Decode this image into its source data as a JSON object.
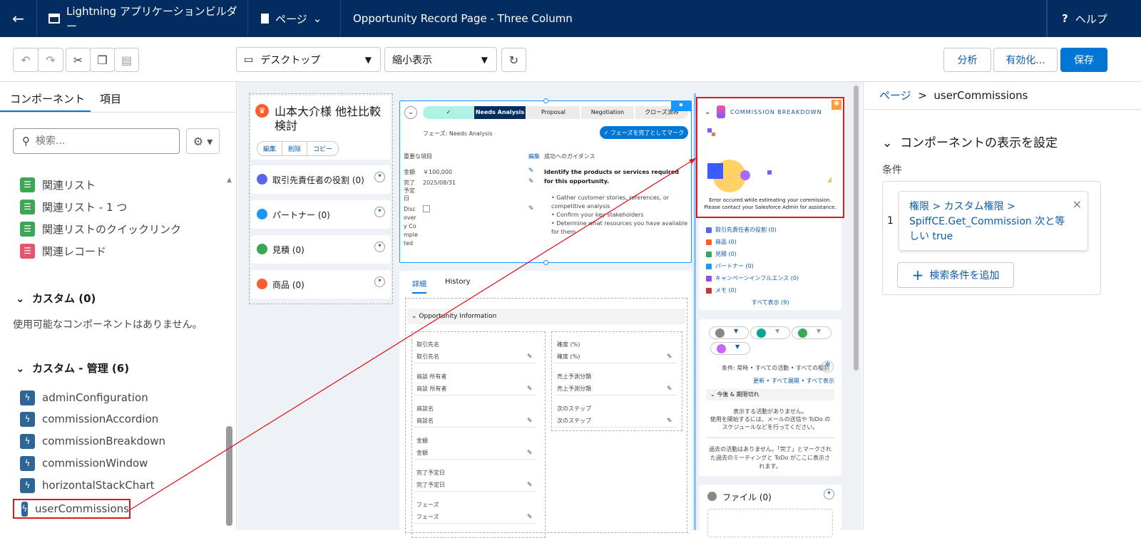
{
  "header": {
    "back_icon": "arrow-left-icon",
    "app_name": "Lightning アプリケーションビルダー",
    "page_menu": "ページ",
    "page_title": "Opportunity Record Page - Three Column",
    "help": "ヘルプ"
  },
  "toolbar": {
    "device": "デスクトップ",
    "zoom": "縮小表示",
    "analyze": "分析",
    "activate": "有効化...",
    "save": "保存"
  },
  "left": {
    "tab_components": "コンポーネント",
    "tab_fields": "項目",
    "search_placeholder": "検索...",
    "related_items": [
      {
        "label": "関連リスト",
        "color": "#3ba755"
      },
      {
        "label": "関連リスト - 1 つ",
        "color": "#3ba755"
      },
      {
        "label": "関連リストのクイックリンク",
        "color": "#3ba755"
      },
      {
        "label": "関連レコード",
        "color": "#e3566b"
      }
    ],
    "custom_header": "カスタム (0)",
    "custom_empty": "使用可能なコンポーネントはありません。",
    "custom_managed_header": "カスタム - 管理 (6)",
    "managed_items": [
      "adminConfiguration",
      "commissionAccordion",
      "commissionBreakdown",
      "commissionWindow",
      "horizontalStackChart",
      "userCommissions"
    ]
  },
  "canvas": {
    "record_title": "山本大介様 他社比較検討",
    "btn_edit": "編集",
    "btn_delete": "削除",
    "btn_copy": "コピー",
    "related": [
      {
        "label": "取引先責任者の役割 (0)",
        "color": "#5867e8"
      },
      {
        "label": "パートナー (0)",
        "color": "#1b96ff"
      },
      {
        "label": "見積 (0)",
        "color": "#3ba755"
      },
      {
        "label": "商品 (0)",
        "color": "#ff5d2d"
      }
    ],
    "path_stages": [
      "Needs Analysis",
      "Proposal",
      "Negotiation",
      "クローズ済み"
    ],
    "phase_text": "フェーズ: Needs Analysis",
    "complete_btn": "フェーズを完了としてマーク",
    "key_fields": "重要な項目",
    "edit": "編集",
    "guidance": "成功へのガイダンス",
    "f_amount_l": "金額",
    "f_amount_v": "￥100,000",
    "f_close_l": "完了予定日",
    "f_close_v": "2025/08/31",
    "f_disc_l": "Discovery Completed",
    "guide_title": "Identify the products or services required for this opportunity.",
    "guide_items": [
      "Gather customer stories, references, or competitive analysis",
      "Confirm your key stakeholders",
      "Determine what resources you have available for them"
    ],
    "tab_detail": "詳細",
    "tab_history": "History",
    "section": "Opportunity Information",
    "left_fields": [
      [
        "取引先名",
        "取引先名"
      ],
      [
        "商談 所有者",
        "商談 所有者"
      ],
      [
        "商談名",
        "商談名"
      ],
      [
        "金額",
        "金額"
      ],
      [
        "完了予定日",
        "完了予定日"
      ],
      [
        "フェーズ",
        "フェーズ"
      ]
    ],
    "right_fields": [
      [
        "確度 (%)",
        "確度 (%)"
      ],
      [
        "売上予測分類",
        "売上予測分類"
      ],
      [
        "次のステップ",
        "次のステップ"
      ]
    ],
    "cb_title": "COMMISSION BREAKDOWN",
    "cb_err1": "Error occured while estimating your commission.",
    "cb_err2": "Please contact your Salesforce Admin for assistance.",
    "right_links": [
      {
        "label": "取引先責任者の役割 (0)",
        "color": "#5867e8"
      },
      {
        "label": "商品 (0)",
        "color": "#ff5d2d"
      },
      {
        "label": "見積 (0)",
        "color": "#3ba755"
      },
      {
        "label": "パートナー (0)",
        "color": "#1b96ff"
      },
      {
        "label": "キャンペーンインフルエンス (0)",
        "color": "#9050e9"
      },
      {
        "label": "メモ (0)",
        "color": "#c23934"
      }
    ],
    "show_all": "すべて表示 (9)",
    "filter": "条件: 常時 • すべての活動 • すべての種別",
    "refresh": "更新",
    "expand_all": "すべて展開",
    "view_all": "すべて表示",
    "upcoming": "今後 & 期限切れ",
    "no_activity": "表示する活動がありません。",
    "start_hint": "使用を開始するには、メールの送信や ToDo のスケジュールなどを行ってください。",
    "past": "過去の活動はありません。「完了」とマークされた過去のミーティングと ToDo がここに表示されます。",
    "files": "ファイル (0)"
  },
  "right": {
    "breadcrumb_page": "ページ",
    "breadcrumb_sep": ">",
    "breadcrumb_comp": "userCommissions",
    "visibility_header": "コンポーネントの表示を設定",
    "conditions_label": "条件",
    "cond_num": "1",
    "cond_text": "権限 > カスタム権限 > SpiffCE.Get_Commission 次と等しい true",
    "add_filter": "検索条件を追加"
  }
}
